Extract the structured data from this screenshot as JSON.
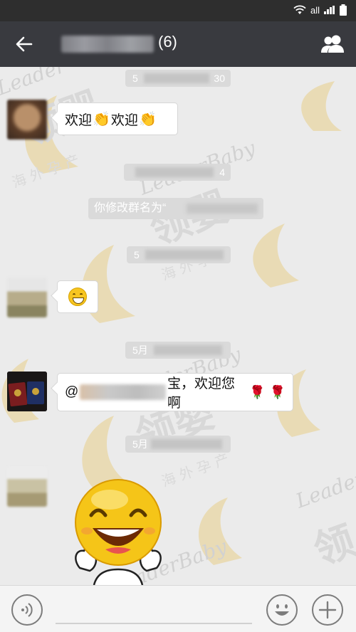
{
  "status_bar": {
    "signal_label": "all",
    "icons": [
      "wifi-icon",
      "signal-icon",
      "battery-icon"
    ]
  },
  "header": {
    "back_icon": "arrow-left-icon",
    "member_count": "(6)",
    "members_icon": "group-members-icon"
  },
  "timestamps": [
    {
      "label": "5",
      "suffix": "30"
    },
    {
      "label": "",
      "suffix": "4"
    },
    {
      "label": "5",
      "suffix": ""
    },
    {
      "label": "5月",
      "suffix": ""
    },
    {
      "label": "5月",
      "suffix": ""
    }
  ],
  "system_message": {
    "text": "你修改群名为“"
  },
  "messages": [
    {
      "text_a": "欢迎",
      "text_b": "欢迎",
      "icon": "clapping-hands-icon"
    },
    {
      "icon": "grinning-face-icon"
    },
    {
      "prefix": "@",
      "text": "宝，欢迎您啊",
      "icon": "rose-icon"
    },
    {
      "icon": "smiley-sticker-icon"
    }
  ],
  "watermark": {
    "brand": "LeaderBaby",
    "cn_name": "领婴",
    "tagline": "海外孕产"
  },
  "input_bar": {
    "voice_icon": "voice-icon",
    "emoji_icon": "emoji-icon",
    "plus_icon": "plus-icon"
  },
  "colors": {
    "title_bar": "#393a3f",
    "status_bar": "#2e2e2e",
    "chat_bg": "#ebebeb",
    "watermark_gold": "#e9cf8a"
  }
}
